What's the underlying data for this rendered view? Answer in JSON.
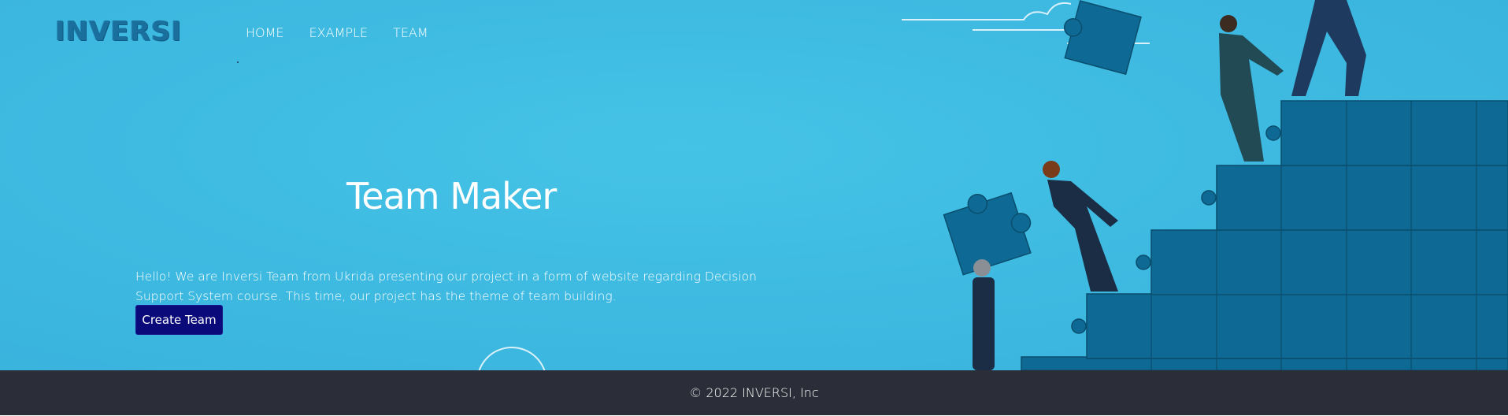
{
  "brand": {
    "logo_text": "INVERSI"
  },
  "nav": {
    "items": [
      {
        "label": "HOME"
      },
      {
        "label": "EXAMPLE"
      },
      {
        "label": "TEAM"
      }
    ]
  },
  "hero": {
    "title": "Team Maker",
    "description": "Hello! We are Inversi Team from Ukrida presenting our project in a form of website regarding Decision Support System course. This time, our project has the theme of team building.",
    "cta_label": "Create Team"
  },
  "footer": {
    "copyright": "© 2022 INVERSI, Inc"
  },
  "colors": {
    "hero_background": "#40bbe2",
    "button": "#0a0a7a",
    "footer": "#2b2e38",
    "puzzle": "#0e6a94"
  }
}
